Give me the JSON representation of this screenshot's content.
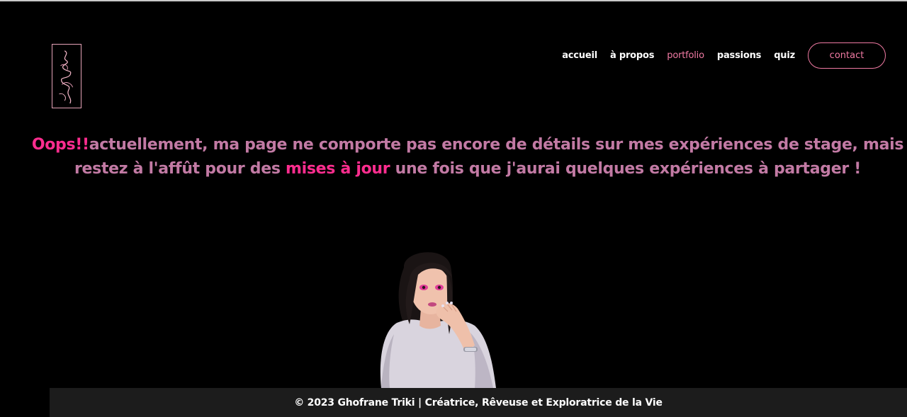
{
  "nav": {
    "items": [
      {
        "label": "accueil",
        "active": false
      },
      {
        "label": "à propos",
        "active": false
      },
      {
        "label": "portfolio",
        "active": true
      },
      {
        "label": "passions",
        "active": false
      },
      {
        "label": "quiz",
        "active": false
      }
    ],
    "contact_label": "contact"
  },
  "message": {
    "part1": "Oops!!",
    "part2": "actuellement, ma page ne comporte pas encore de détails sur mes expériences de stage, mais restez à l'affût pour des ",
    "part3": "mises à jour",
    "part4": " une fois que j'aurai quelques expériences à partager !"
  },
  "footer": {
    "text": "© 2023 Ghofrane Triki | Créatrice, Rêveuse et Exploratrice de la Vie"
  },
  "colors": {
    "background": "#000000",
    "accent_pink": "#f07aa3",
    "highlight_pink": "#ff2d8f",
    "message_text": "#c27aa4",
    "footer_bg": "#1c1c1c"
  },
  "icons": {
    "logo": "signature-logo",
    "illustration": "girl-avatar-illustration"
  }
}
